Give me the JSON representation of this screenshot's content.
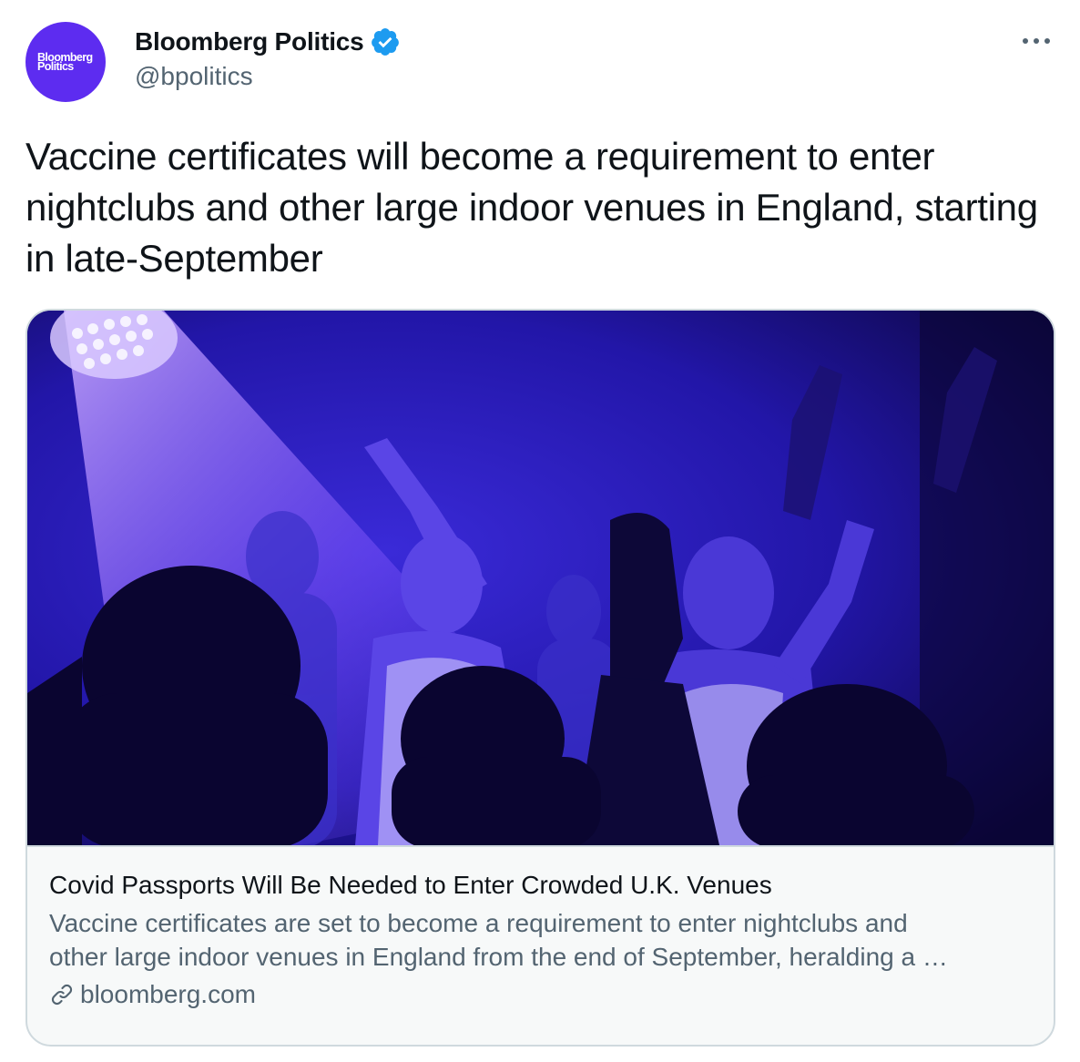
{
  "author": {
    "display_name": "Bloomberg Politics",
    "handle": "@bpolitics",
    "avatar_text_line1": "Bloomberg",
    "avatar_text_line2": "Politics",
    "avatar_color": "#5d2cf0",
    "verified_icon": "verified-badge-icon",
    "verified_color": "#1d9bf0"
  },
  "more_menu_icon": "more-horizontal-icon",
  "tweet": {
    "text": "Vaccine certificates will become a requirement to enter nightclubs and other large indoor venues in England, starting in late-September"
  },
  "card": {
    "image_icon": "nightclub-photo",
    "title": "Covid Passports Will Be Needed to Enter Crowded U.K. Venues",
    "description_line1": "Vaccine certificates are set to become a requirement to enter nightclubs and",
    "description_line2": "other large indoor venues in England from the end of September, heralding a …",
    "domain": "bloomberg.com",
    "domain_icon": "link-icon"
  }
}
